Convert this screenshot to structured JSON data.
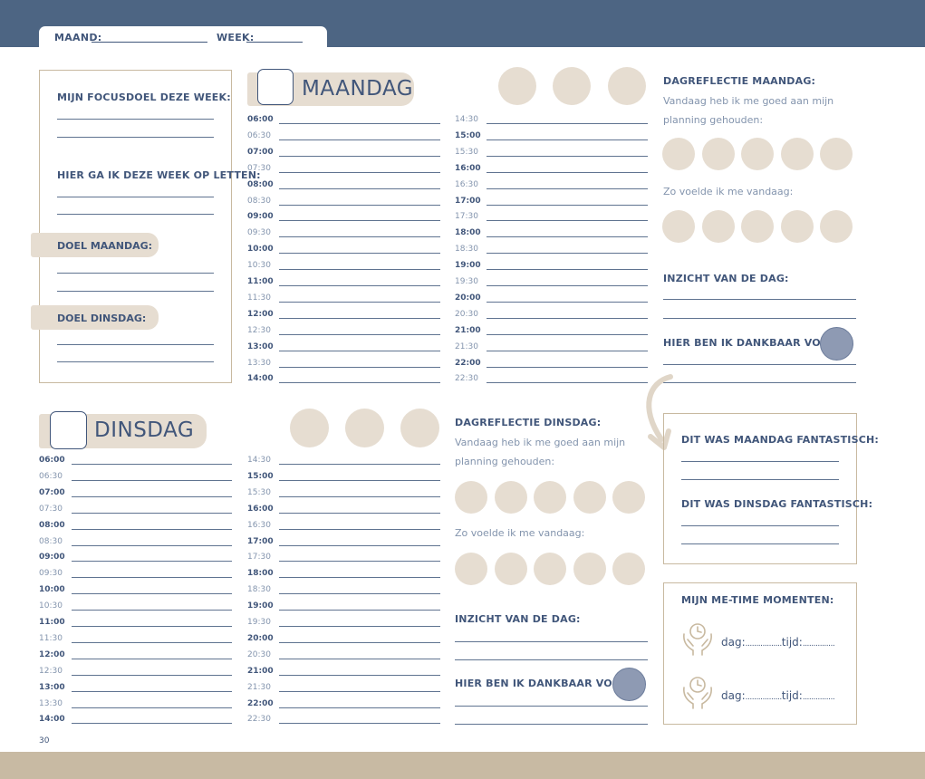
{
  "header": {
    "maand_label": "MAAND:",
    "week_label": "WEEK:"
  },
  "focus": {
    "title": "MIJN FOCUSDOEL DEZE WEEK:",
    "letten": "HIER GA IK DEZE WEEK OP LETTEN:",
    "doel_maandag": "DOEL MAANDAG:",
    "doel_dinsdag": "DOEL DINSDAG:"
  },
  "maandag": {
    "title": "MAANDAG",
    "times_left": [
      "06:00",
      "06:30",
      "07:00",
      "07:30",
      "08:00",
      "08:30",
      "09:00",
      "09:30",
      "10:00",
      "10:30",
      "11:00",
      "11:30",
      "12:00",
      "12:30",
      "13:00",
      "13:30",
      "14:00"
    ],
    "times_right": [
      "14:30",
      "15:00",
      "15:30",
      "16:00",
      "16:30",
      "17:00",
      "17:30",
      "18:00",
      "18:30",
      "19:00",
      "19:30",
      "20:00",
      "20:30",
      "21:00",
      "21:30",
      "22:00",
      "22:30"
    ]
  },
  "dinsdag": {
    "title": "DINSDAG",
    "times_left": [
      "06:00",
      "06:30",
      "07:00",
      "07:30",
      "08:00",
      "08:30",
      "09:00",
      "09:30",
      "10:00",
      "10:30",
      "11:00",
      "11:30",
      "12:00",
      "12:30",
      "13:00",
      "13:30",
      "14:00"
    ],
    "times_right": [
      "14:30",
      "15:00",
      "15:30",
      "16:00",
      "16:30",
      "17:00",
      "17:30",
      "18:00",
      "18:30",
      "19:00",
      "19:30",
      "20:00",
      "20:30",
      "21:00",
      "21:30",
      "22:00",
      "22:30"
    ]
  },
  "reflectie_maandag": {
    "title": "DAGREFLECTIE MAANDAG:",
    "line1": "Vandaag heb ik me goed aan mijn",
    "line2": "planning gehouden:",
    "feel": "Zo voelde ik me vandaag:",
    "inzicht": "INZICHT VAN DE DAG:",
    "dankbaar": "HIER BEN IK DANKBAAR VOOR:"
  },
  "reflectie_dinsdag": {
    "title": "DAGREFLECTIE DINSDAG:",
    "line1": "Vandaag heb ik me goed aan mijn",
    "line2": "planning gehouden:",
    "feel": "Zo voelde ik me vandaag:",
    "inzicht": "INZICHT VAN DE DAG:",
    "dankbaar": "HIER BEN IK DANKBAAR VOOR:"
  },
  "fantastisch": {
    "maandag": "DIT WAS MAANDAG FANTASTISCH:",
    "dinsdag": "DIT WAS DINSDAG FANTASTISCH:"
  },
  "metime": {
    "title": "MIJN ME-TIME MOMENTEN:",
    "dag": "dag:",
    "tijd": "tijd:"
  },
  "page_number": "30",
  "colors": {
    "navy": "#4d6583",
    "beige": "#e6ddd1",
    "sand": "#c8baa3",
    "accent_blue": "#8e9ab3"
  },
  "icons": [
    "clock-hands-icon",
    "curved-arrow-icon"
  ]
}
